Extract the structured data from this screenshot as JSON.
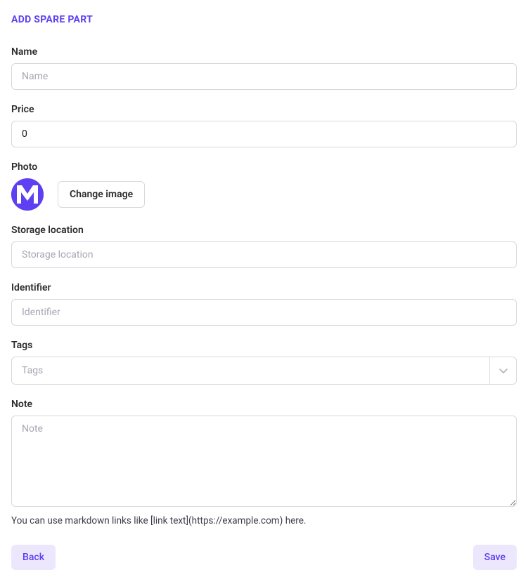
{
  "title": "ADD SPARE PART",
  "fields": {
    "name": {
      "label": "Name",
      "placeholder": "Name",
      "value": ""
    },
    "price": {
      "label": "Price",
      "value": "0"
    },
    "photo": {
      "label": "Photo",
      "change_button": "Change image"
    },
    "storage_location": {
      "label": "Storage location",
      "placeholder": "Storage location",
      "value": ""
    },
    "identifier": {
      "label": "Identifier",
      "placeholder": "Identifier",
      "value": ""
    },
    "tags": {
      "label": "Tags",
      "placeholder": "Tags",
      "value": ""
    },
    "note": {
      "label": "Note",
      "placeholder": "Note",
      "value": "",
      "helper": "You can use markdown links like [link text](https://example.com) here."
    }
  },
  "buttons": {
    "back": "Back",
    "save": "Save"
  },
  "colors": {
    "accent": "#5e3ff2",
    "soft_bg": "#ece7fd",
    "border": "#d7d7de"
  }
}
